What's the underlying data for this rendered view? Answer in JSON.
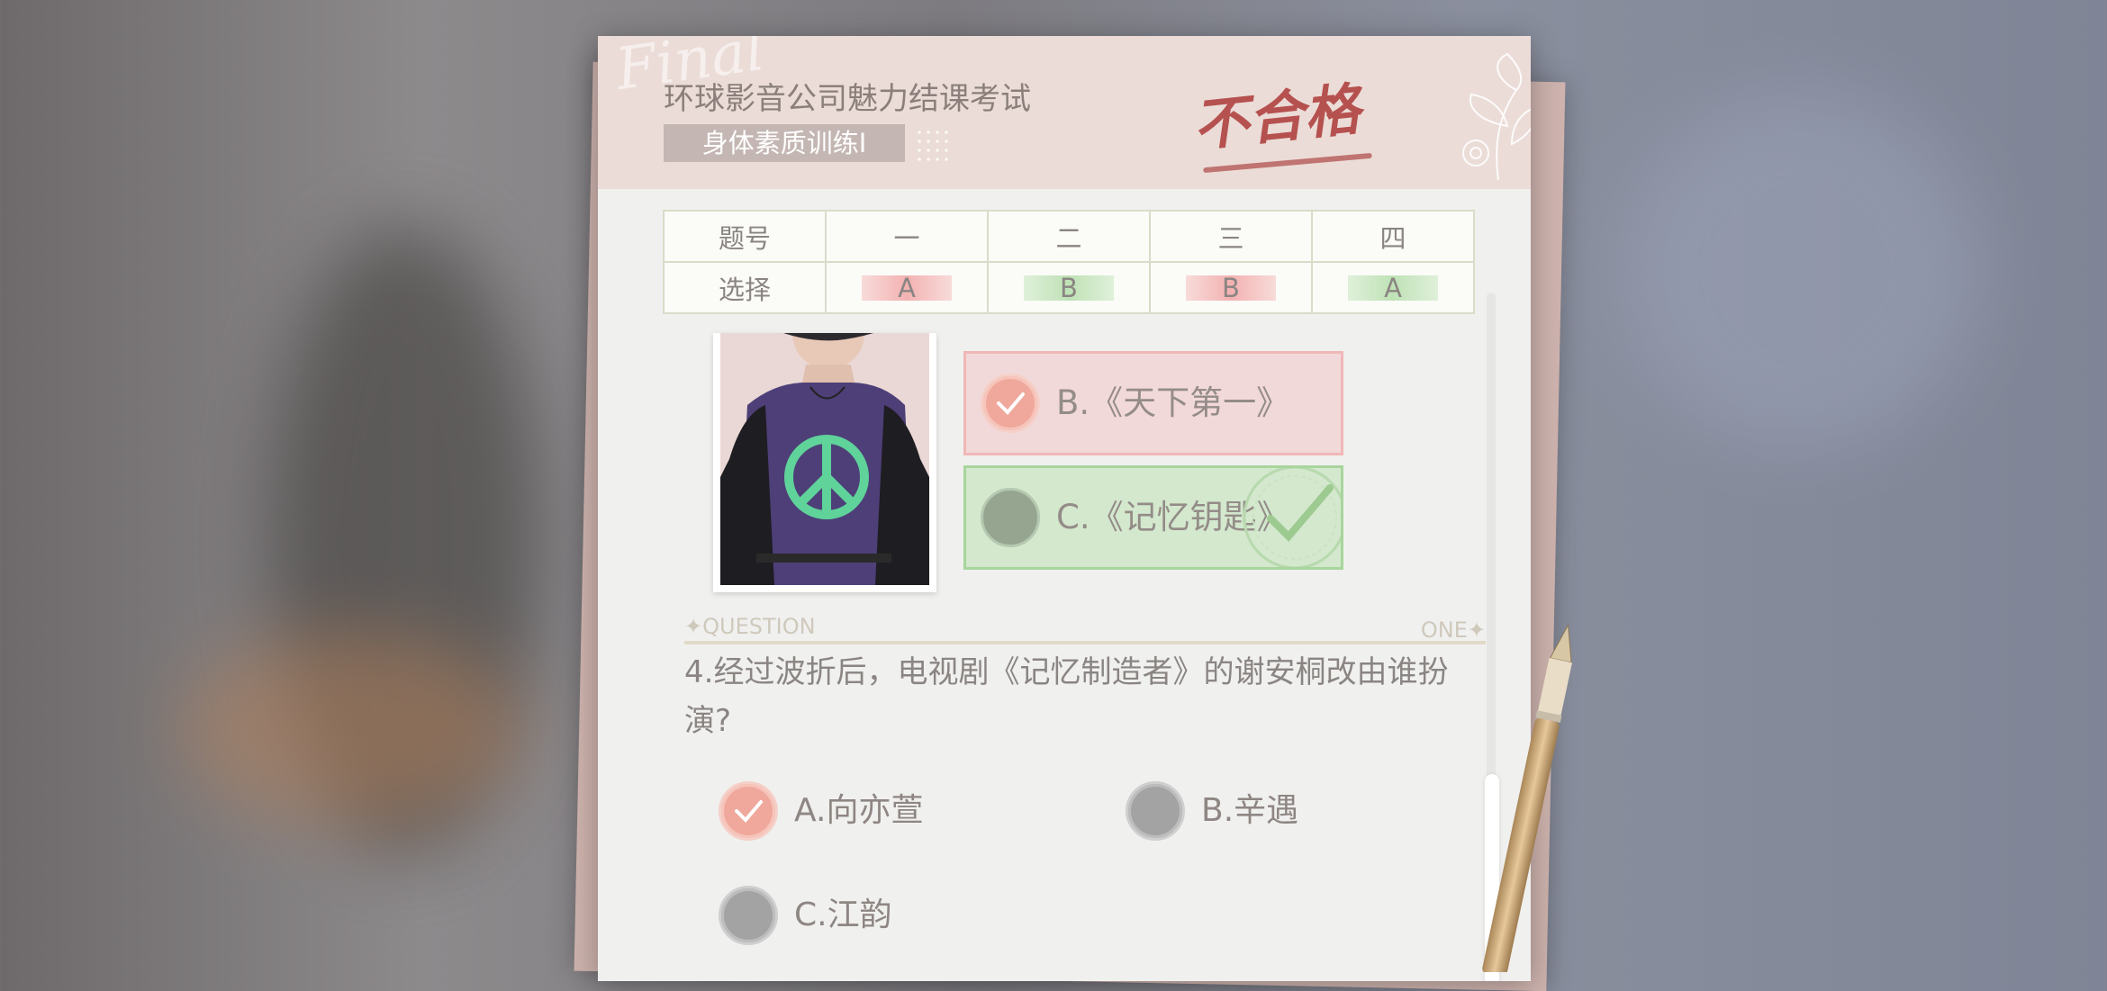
{
  "exam": {
    "title": "环球影音公司魅力结课考试",
    "subject": "身体素质训练Ⅰ",
    "result_stamp": "不合格",
    "decor_script": "Final"
  },
  "answer_table": {
    "header_label": "题号",
    "row_label": "选择",
    "columns": [
      "一",
      "二",
      "三",
      "四"
    ],
    "answers": [
      {
        "choice": "A",
        "status": "wrong"
      },
      {
        "choice": "B",
        "status": "correct"
      },
      {
        "choice": "B",
        "status": "wrong"
      },
      {
        "choice": "A",
        "status": "correct"
      }
    ]
  },
  "question_3": {
    "options": [
      {
        "label": "B.《天下第一》",
        "state": "selected-wrong"
      },
      {
        "label": "C.《记忆钥匙》",
        "state": "correct-answer"
      }
    ]
  },
  "question_4": {
    "banner_left": "QUESTION",
    "banner_right": "ONE",
    "text": "4.经过波折后，电视剧《记忆制造者》的谢安桐改由谁扮演?",
    "options": [
      {
        "label": "A.向亦萱",
        "state": "selected"
      },
      {
        "label": "B.辛遇",
        "state": "unselected"
      },
      {
        "label": "C.江韵",
        "state": "unselected"
      }
    ]
  },
  "colors": {
    "wrong": "#f3b2b2",
    "correct": "#bfe2b6",
    "stamp": "#b5514f",
    "paper": "#f0f0ef",
    "header": "#ebdcd7"
  },
  "icons": [
    "check-icon",
    "pen-icon",
    "flower-decoration",
    "sparkle-icon"
  ]
}
